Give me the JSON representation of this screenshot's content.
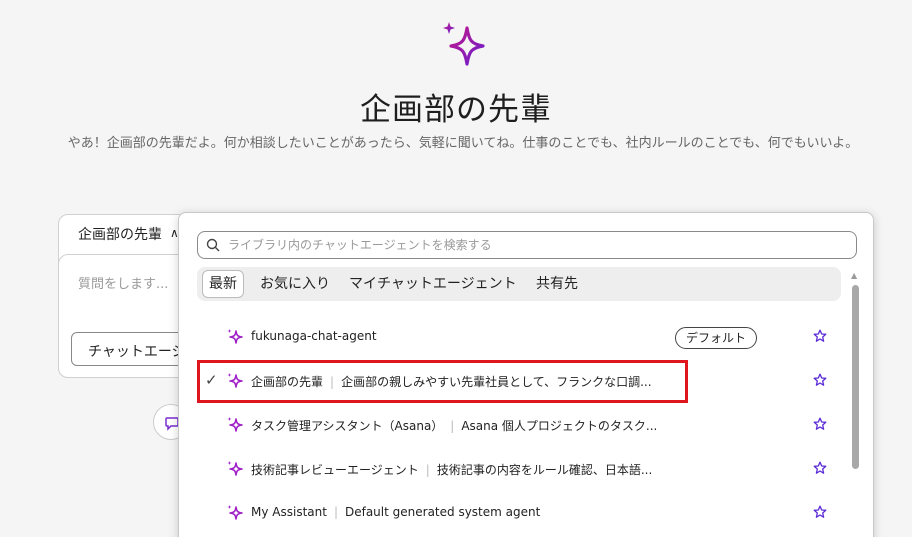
{
  "hero": {
    "title": "企画部の先輩",
    "description": "やあ！企画部の先輩だよ。何か相談したいことがあったら、気軽に聞いてね。仕事のことでも、社内ルールのことでも、何でもいいよ。"
  },
  "background_card": {
    "tab_label": "企画部の先輩",
    "input_placeholder": "質問をします...",
    "agent_button_label": "チャットエージェント"
  },
  "popover": {
    "search_placeholder": "ライブラリ内のチャットエージェントを検索する",
    "tabs": [
      {
        "label": "最新",
        "active": true
      },
      {
        "label": "お気に入り",
        "active": false
      },
      {
        "label": "マイチャットエージェント",
        "active": false
      },
      {
        "label": "共有先",
        "active": false
      }
    ],
    "agents": [
      {
        "name": "fukunaga-chat-agent",
        "description": "",
        "badge": "デフォルト",
        "selected": false
      },
      {
        "name": "企画部の先輩",
        "description": "企画部の親しみやすい先輩社員として、フランクな口調...",
        "badge": "",
        "selected": true
      },
      {
        "name": "タスク管理アシスタント（Asana）",
        "description": "Asana 個人プロジェクトのタスク...",
        "badge": "",
        "selected": false
      },
      {
        "name": "技術記事レビューエージェント",
        "description": "技術記事の内容をルール確認、日本語...",
        "badge": "",
        "selected": false
      },
      {
        "name": "My Assistant",
        "description": "Default generated system agent",
        "badge": "",
        "selected": false
      }
    ]
  },
  "colors": {
    "accent": "#a020c8",
    "highlight": "#e0161f",
    "star": "#5b2bd6"
  }
}
